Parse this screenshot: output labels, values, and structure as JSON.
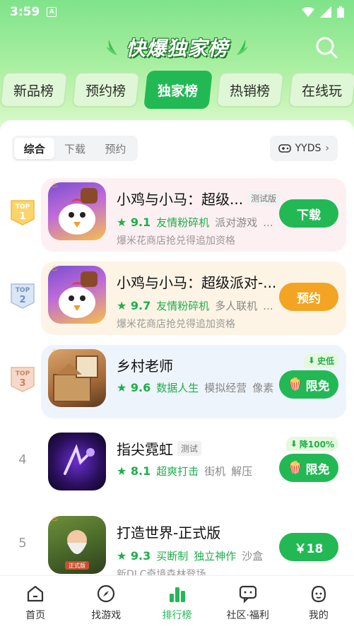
{
  "status_bar": {
    "time": "3:59",
    "notification_glyph": "A"
  },
  "header": {
    "title": "快爆独家榜"
  },
  "tabs": [
    {
      "label": "新品榜",
      "active": false
    },
    {
      "label": "预约榜",
      "active": false
    },
    {
      "label": "独家榜",
      "active": true
    },
    {
      "label": "热销榜",
      "active": false
    },
    {
      "label": "在线玩",
      "active": false
    }
  ],
  "filter": {
    "options": [
      {
        "label": "综合",
        "active": true
      },
      {
        "label": "下载",
        "active": false
      },
      {
        "label": "预约",
        "active": false
      }
    ],
    "yyds_label": "YYDS"
  },
  "games": [
    {
      "rank_badge": "TOP",
      "rank": "1",
      "name": "小鸡与小马：超级...",
      "chip": "测试版",
      "score": "9.1",
      "tags": [
        "友情粉碎机",
        "派对游戏",
        "..."
      ],
      "subtitle": "爆米花商店抢兑得追加资格",
      "action": "下载",
      "action_color": "#22b955",
      "highlight": "#fdf0f2"
    },
    {
      "rank_badge": "TOP",
      "rank": "2",
      "name": "小鸡与小马：超级派对-...",
      "chip": "",
      "score": "9.7",
      "tags": [
        "友情粉碎机",
        "多人联机",
        "..."
      ],
      "subtitle": "爆米花商店抢兑得追加资格",
      "action": "预约",
      "action_color": "#f3a423",
      "highlight": "#fdf4e6"
    },
    {
      "rank_badge": "TOP",
      "rank": "3",
      "name": "乡村老师",
      "chip": "",
      "score": "9.6",
      "tags": [
        "数据人生",
        "模拟经营",
        "像素"
      ],
      "subtitle": "",
      "action": "限免",
      "action_color": "#22b955",
      "highlight": "#eef4fb",
      "top_badge": "史低"
    },
    {
      "rank_badge": "",
      "rank": "4",
      "name": "指尖霓虹",
      "chip": "测试",
      "score": "8.1",
      "tags": [
        "超爽打击",
        "街机",
        "解压"
      ],
      "subtitle": "",
      "action": "限免",
      "action_color": "#22b955",
      "highlight": "",
      "top_badge": "降100%"
    },
    {
      "rank_badge": "",
      "rank": "5",
      "name": "打造世界-正式版",
      "chip": "",
      "score": "9.3",
      "tags": [
        "买断制",
        "独立神作",
        "沙盒"
      ],
      "subtitle": "新DLC奇境森林登场",
      "action": "￥18",
      "action_color": "#22b955",
      "highlight": "",
      "icon_label": "正式版"
    }
  ],
  "bottom_nav": [
    {
      "label": "首页",
      "icon": "home-icon",
      "active": false
    },
    {
      "label": "找游戏",
      "icon": "compass-icon",
      "active": false
    },
    {
      "label": "排行榜",
      "icon": "bar-chart-icon",
      "active": true
    },
    {
      "label": "社区·福利",
      "icon": "chat-icon",
      "active": false
    },
    {
      "label": "我的",
      "icon": "profile-icon",
      "active": false
    }
  ],
  "colors": {
    "accent": "#22b955",
    "orange": "#f3a423"
  }
}
